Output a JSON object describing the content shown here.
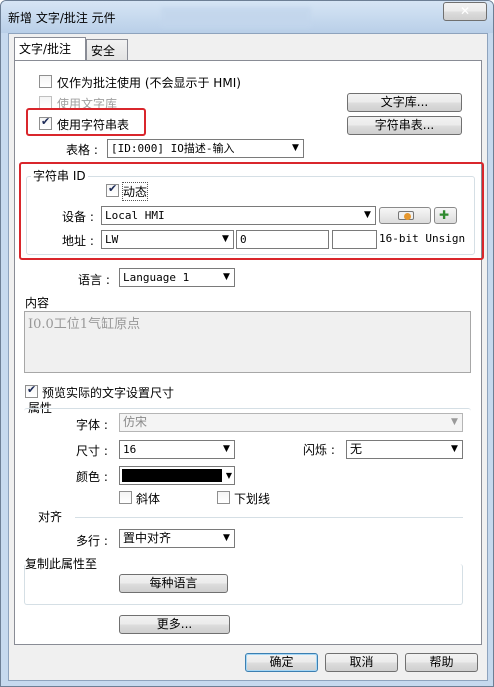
{
  "window": {
    "title": "新增 文字/批注 元件",
    "close_glyph": "✕"
  },
  "tabs": [
    {
      "label": "文字/批注",
      "active": true
    },
    {
      "label": "安全",
      "active": false
    }
  ],
  "options": {
    "comment_only": {
      "label": "仅作为批注使用 (不会显示于 HMI)",
      "checked": false
    },
    "use_text_library": {
      "label": "使用文字库",
      "checked": false,
      "enabled": false
    },
    "use_string_table": {
      "label": "使用字符串表",
      "checked": true
    },
    "text_library_button": "文字库...",
    "string_table_button": "字符串表..."
  },
  "table": {
    "label": "表格 :",
    "value": "[ID:000] IO描述-输入"
  },
  "string_id": {
    "group_label": "字符串 ID",
    "dynamic": {
      "label": "动态",
      "checked": true
    },
    "device_label": "设备 :",
    "device_value": "Local HMI",
    "address_label": "地址 :",
    "address_type": "LW",
    "address_value": "0",
    "address_extra": "",
    "data_format": "16-bit Unsign"
  },
  "language": {
    "label": "语言 :",
    "value": "Language 1"
  },
  "content": {
    "label": "内容",
    "text": "I0.0工位1气缸原点"
  },
  "preview_real_size": {
    "label": "预览实际的文字设置尺寸",
    "checked": true
  },
  "attributes": {
    "label": "属性",
    "font_label": "字体 :",
    "font_value": "仿宋",
    "size_label": "尺寸 :",
    "size_value": "16",
    "blink_label": "闪烁 :",
    "blink_value": "无",
    "color_label": "颜色 :",
    "color_value": "#000000",
    "italic": {
      "label": "斜体",
      "checked": false
    },
    "underline": {
      "label": "下划线",
      "checked": false
    }
  },
  "alignment": {
    "label": "对齐",
    "multiline_label": "多行 :",
    "multiline_value": "置中对齐"
  },
  "copy_attributes": {
    "label": "复制此属性至",
    "each_language_button": "每种语言"
  },
  "more_button": "更多...",
  "footer": {
    "ok": "确定",
    "cancel": "取消",
    "help": "帮助"
  },
  "colors": {
    "highlight_red": "#d9262c",
    "title_bar": "#c6d9ee"
  }
}
